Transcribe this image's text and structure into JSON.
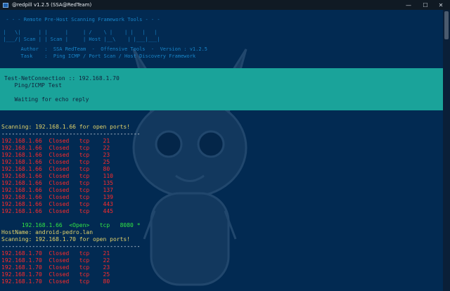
{
  "window": {
    "title": "@redpill v1.2.5 (SSA@RedTeam)",
    "controls": {
      "minimize": "—",
      "maximize": "☐",
      "close": "✕"
    }
  },
  "banner": {
    "lines": [
      "  - - - Remote Pre-Host Scanning Framework Tools - - -",
      " |   \\|      | |      |     | /    \\ |    | |   |   |",
      " |___/| Scan | | Scan |     | Host |__\\    | |___|___|",
      "       Author  :  SSA RedTeam  -  Offensive Tools  -  Version : v1.2.5",
      "       Task    :  Ping ICMP / Port Scan / Host Discovery Framework"
    ]
  },
  "test_panel": {
    "line1": "Test-NetConnection :: 192.168.1.70",
    "line2": "   Ping/ICMP Test",
    "line3": "   Waiting for echo reply"
  },
  "scan1": {
    "header": "Scanning: 192.168.1.66 for open ports!",
    "separator": "-----------------------------------------",
    "rows": [
      {
        "ip": "192.168.1.66",
        "status": "Closed",
        "proto": "tcp",
        "port": "21"
      },
      {
        "ip": "192.168.1.66",
        "status": "Closed",
        "proto": "tcp",
        "port": "22"
      },
      {
        "ip": "192.168.1.66",
        "status": "Closed",
        "proto": "tcp",
        "port": "23"
      },
      {
        "ip": "192.168.1.66",
        "status": "Closed",
        "proto": "tcp",
        "port": "25"
      },
      {
        "ip": "192.168.1.66",
        "status": "Closed",
        "proto": "tcp",
        "port": "80"
      },
      {
        "ip": "192.168.1.66",
        "status": "Closed",
        "proto": "tcp",
        "port": "110"
      },
      {
        "ip": "192.168.1.66",
        "status": "Closed",
        "proto": "tcp",
        "port": "135"
      },
      {
        "ip": "192.168.1.66",
        "status": "Closed",
        "proto": "tcp",
        "port": "137"
      },
      {
        "ip": "192.168.1.66",
        "status": "Closed",
        "proto": "tcp",
        "port": "139"
      },
      {
        "ip": "192.168.1.66",
        "status": "Closed",
        "proto": "tcp",
        "port": "443"
      },
      {
        "ip": "192.168.1.66",
        "status": "Closed",
        "proto": "tcp",
        "port": "445"
      }
    ],
    "open_row": {
      "ip": "192.168.1.66",
      "status": "<Open>",
      "proto": "tcp",
      "port": "8080",
      "mark": "*"
    }
  },
  "host2": {
    "hostname": "HostName: android-pedro.lan",
    "header": "Scanning: 192.168.1.70 for open ports!",
    "separator": "-----------------------------------------",
    "rows": [
      {
        "ip": "192.168.1.70",
        "status": "Closed",
        "proto": "tcp",
        "port": "21"
      },
      {
        "ip": "192.168.1.70",
        "status": "Closed",
        "proto": "tcp",
        "port": "22"
      },
      {
        "ip": "192.168.1.70",
        "status": "Closed",
        "proto": "tcp",
        "port": "23"
      },
      {
        "ip": "192.168.1.70",
        "status": "Closed",
        "proto": "tcp",
        "port": "25"
      },
      {
        "ip": "192.168.1.70",
        "status": "Closed",
        "proto": "tcp",
        "port": "80"
      }
    ]
  },
  "colors": {
    "background": "#022a52",
    "panel": "#1aa39a",
    "closed": "#ff2b2b",
    "open": "#31e545",
    "header": "#e3d36a"
  }
}
